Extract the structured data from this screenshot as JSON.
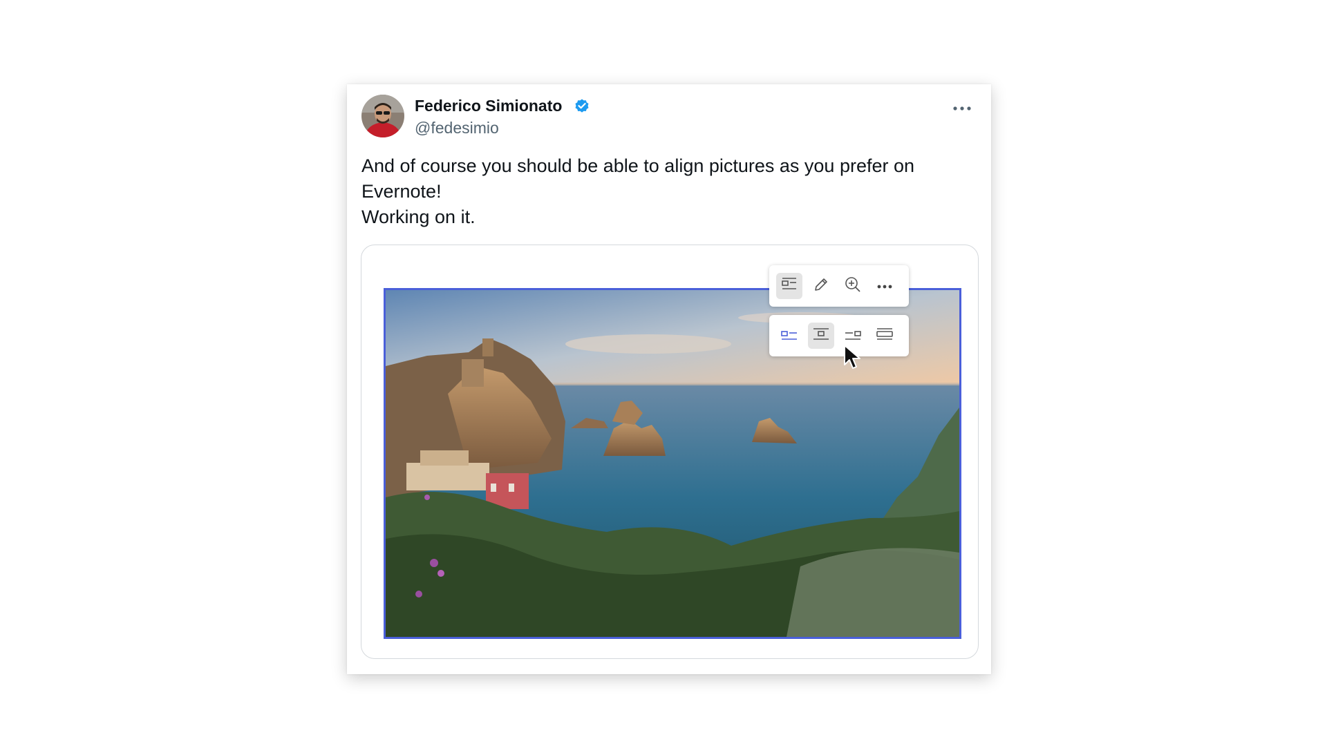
{
  "tweet": {
    "author_name": "Federico Simionato",
    "author_handle": "@fedesimio",
    "verified_icon": "verified-badge-icon",
    "more_icon": "more-horizontal-icon",
    "text_lines": [
      "And of course you should be able to align pictures as you prefer on",
      "Evernote!",
      "Working on it."
    ]
  },
  "image_toolbar": {
    "buttons": [
      {
        "icon": "align-left-wrap-icon",
        "active": true
      },
      {
        "icon": "pencil-edit-icon",
        "active": false
      },
      {
        "icon": "zoom-in-icon",
        "active": false
      },
      {
        "icon": "more-horizontal-icon",
        "active": false
      }
    ]
  },
  "alignment_menu": {
    "options": [
      {
        "icon": "align-left-icon",
        "active": false,
        "highlight": true
      },
      {
        "icon": "align-center-icon",
        "active": true,
        "hovered": true
      },
      {
        "icon": "align-right-icon",
        "active": false
      },
      {
        "icon": "align-full-width-icon",
        "active": false
      }
    ]
  },
  "colors": {
    "accent_blue": "#4a5fd9",
    "verified_blue": "#1d9bf0",
    "text_primary": "#0f1419",
    "text_secondary": "#536471"
  }
}
